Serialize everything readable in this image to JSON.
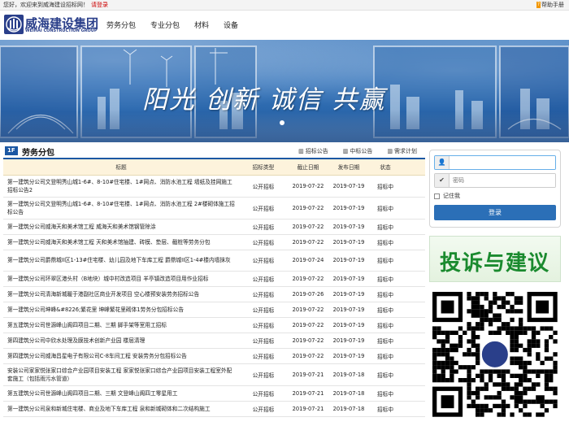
{
  "topbar": {
    "greeting": "您好，欢迎来到威海建设招标网！",
    "login_link": "请登录",
    "help": "帮助手册"
  },
  "header": {
    "logo_cn": "威海建设集团",
    "logo_en": "WEIHAI CONSTRUCTION GROUP",
    "nav": [
      "劳务分包",
      "专业分包",
      "材料",
      "设备"
    ]
  },
  "banner": {
    "slogan": "阳光 创新 诚信 共赢"
  },
  "section": {
    "floor": "1F",
    "title": "劳务分包",
    "tabs": [
      "招标公告",
      "中标公告",
      "需求计划"
    ],
    "columns": [
      "标题",
      "招标类型",
      "截止日期",
      "发布日期",
      "状态"
    ],
    "rows": [
      {
        "title": "第一建筑分公司文登明秀山城1-6#、8-10#住宅楼、1#网点、消防水池工程 墙纸及挂网施工招标公告2",
        "type": "公开招标",
        "deadline": "2019-07-22",
        "published": "2019-07-19",
        "status": "招标中"
      },
      {
        "title": "第一建筑分公司文登明秀山城1-6#、8-10#住宅楼、1#网点、消防水池工程 2#楼砌体施工招标公告",
        "type": "公开招标",
        "deadline": "2019-07-22",
        "published": "2019-07-19",
        "status": "招标中"
      },
      {
        "title": "第一建筑分公司威海天和美术馆工程 威海天和美术馆钢管除涂",
        "type": "公开招标",
        "deadline": "2019-07-22",
        "published": "2019-07-19",
        "status": "招标中"
      },
      {
        "title": "第一建筑分公司威海天和美术馆工程 天和美术馆抽建、砖模、垫层、截桩等劳务分包",
        "type": "公开招标",
        "deadline": "2019-07-22",
        "published": "2019-07-19",
        "status": "招标中"
      },
      {
        "title": "第一建筑分公司爵鼎城II区1-13#住宅楼、幼儿园及地下车库工程 爵鼎城II区1-4#楼内墙抹灰",
        "type": "公开招标",
        "deadline": "2019-07-24",
        "published": "2019-07-19",
        "status": "招标中"
      },
      {
        "title": "第一建筑分公司环翠区港头村（B地块）城中村改造项目 羊亭镇改造项目用作业招标",
        "type": "公开招标",
        "deadline": "2019-07-22",
        "published": "2019-07-19",
        "status": "招标中"
      },
      {
        "title": "第一建筑分公司清海新城暖于港副社区商业开发项目 空心楼预安装劳务招标公告",
        "type": "公开招标",
        "deadline": "2019-07-26",
        "published": "2019-07-19",
        "status": "招标中"
      },
      {
        "title": "第一建筑分公司坤峰&#8226;繁花里 坤峰繁花里砌体1劳务分包招标公告",
        "type": "公开招标",
        "deadline": "2019-07-22",
        "published": "2019-07-19",
        "status": "招标中"
      },
      {
        "title": "第五建筑分公司世源峰山阁四项目二期、三期 脚手架等室用工招标",
        "type": "公开招标",
        "deadline": "2019-07-22",
        "published": "2019-07-19",
        "status": "招标中"
      },
      {
        "title": "第四建筑分公司中欣水处理及膜技术创新产业园 楼层清理",
        "type": "公开招标",
        "deadline": "2019-07-22",
        "published": "2019-07-19",
        "status": "招标中"
      },
      {
        "title": "第四建筑分公司威海昌星电子有限公司C-8车间工程 安装劳务分包招标公告",
        "type": "公开招标",
        "deadline": "2019-07-22",
        "published": "2019-07-19",
        "status": "招标中"
      },
      {
        "title": "安装公司家家悦张家口综合产业园项目安装工程 家家悦张家口综合产业园项目安装工程室外配套施工（包括雨污水管道）",
        "type": "公开招标",
        "deadline": "2019-07-21",
        "published": "2019-07-18",
        "status": "招标中"
      },
      {
        "title": "第五建筑分公司世源峰山阁四项目二期、三期 文登峰山阁四工零星用工",
        "type": "公开招标",
        "deadline": "2019-07-21",
        "published": "2019-07-18",
        "status": "招标中"
      },
      {
        "title": "第一建筑分公司泉和新城住宅楼、商业及地下车库工程 泉和新城砌体和二次结构施工",
        "type": "公开招标",
        "deadline": "2019-07-21",
        "published": "2019-07-18",
        "status": "招标中"
      }
    ]
  },
  "login": {
    "username_placeholder": "",
    "password_placeholder": "密码",
    "remember": "记住我",
    "submit": "登录"
  },
  "complaint": {
    "text": "投诉与建议"
  }
}
